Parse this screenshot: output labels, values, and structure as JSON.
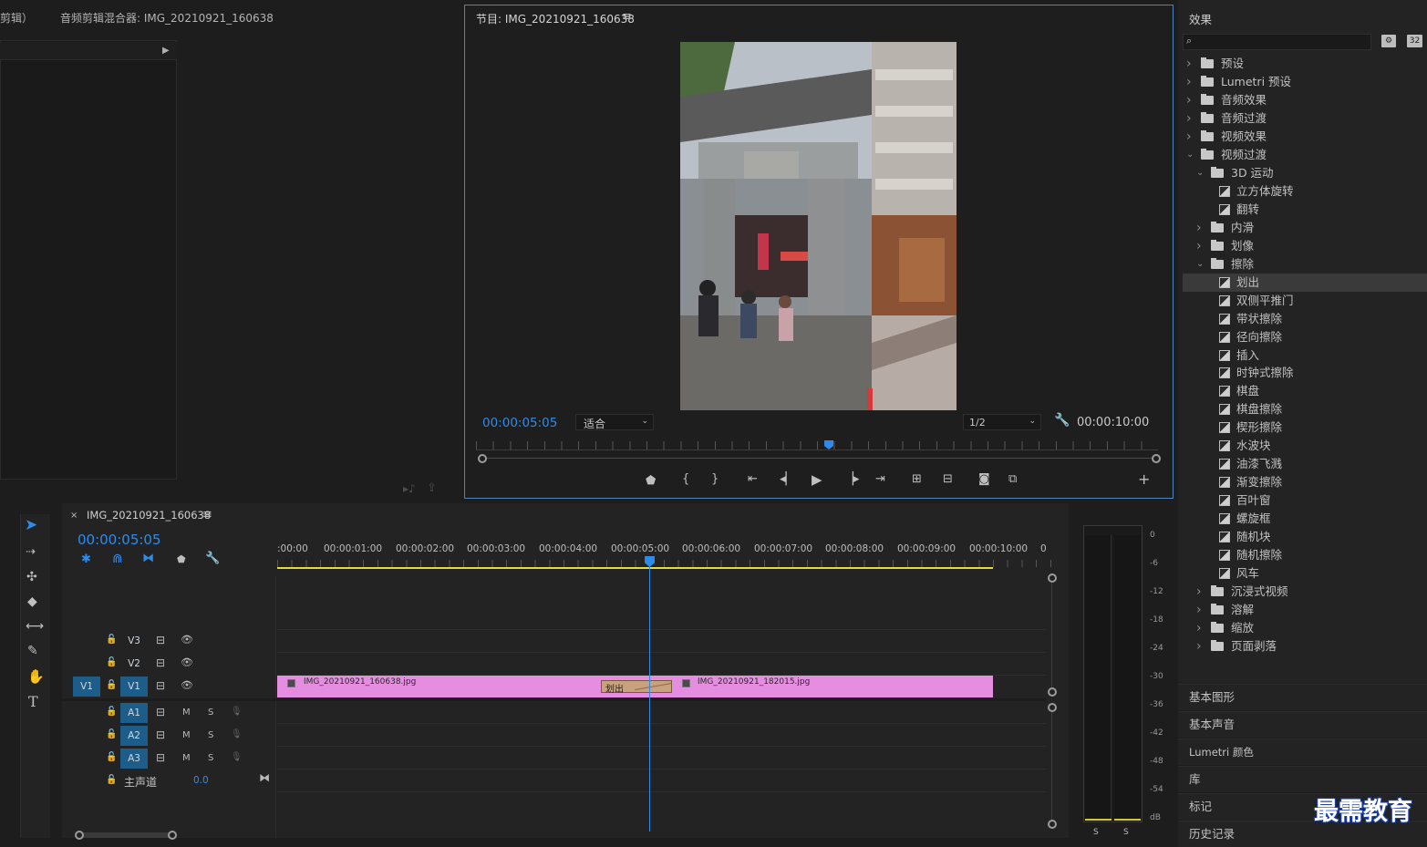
{
  "top_left": {
    "tab_partial": "剪辑）",
    "audio_mixer_title": "音频剪辑混合器: IMG_20210921_160638"
  },
  "program_monitor": {
    "title": "节目: IMG_20210921_160638",
    "menu_icon": "hamburger-icon",
    "timecode": "00:00:05:05",
    "fit_label": "适合",
    "resolution": "1/2",
    "duration": "00:00:10:00",
    "buttons": [
      "marker-icon",
      "mark-in-icon",
      "mark-out-icon",
      "go-to-in-icon",
      "step-back-icon",
      "play-icon",
      "step-forward-icon",
      "go-to-out-icon",
      "lift-icon",
      "extract-icon",
      "camera-icon",
      "compare-icon",
      "add-icon"
    ]
  },
  "effects": {
    "title": "效果",
    "search_placeholder": "",
    "icon_label_32": "32",
    "tree": [
      {
        "label": "预设",
        "level": 0,
        "type": "folder-star",
        "open": false
      },
      {
        "label": "Lumetri 预设",
        "level": 0,
        "type": "folder-star",
        "open": false
      },
      {
        "label": "音频效果",
        "level": 0,
        "type": "folder",
        "open": false
      },
      {
        "label": "音频过渡",
        "level": 0,
        "type": "folder",
        "open": false
      },
      {
        "label": "视频效果",
        "level": 0,
        "type": "folder",
        "open": false
      },
      {
        "label": "视频过渡",
        "level": 0,
        "type": "folder",
        "open": true
      },
      {
        "label": "3D 运动",
        "level": 1,
        "type": "folder",
        "open": true
      },
      {
        "label": "立方体旋转",
        "level": 2,
        "type": "fx"
      },
      {
        "label": "翻转",
        "level": 2,
        "type": "fx"
      },
      {
        "label": "内滑",
        "level": 1,
        "type": "folder",
        "open": false
      },
      {
        "label": "划像",
        "level": 1,
        "type": "folder",
        "open": false
      },
      {
        "label": "擦除",
        "level": 1,
        "type": "folder",
        "open": true
      },
      {
        "label": "划出",
        "level": 2,
        "type": "fx",
        "selected": true
      },
      {
        "label": "双侧平推门",
        "level": 2,
        "type": "fx"
      },
      {
        "label": "带状擦除",
        "level": 2,
        "type": "fx"
      },
      {
        "label": "径向擦除",
        "level": 2,
        "type": "fx"
      },
      {
        "label": "插入",
        "level": 2,
        "type": "fx"
      },
      {
        "label": "时钟式擦除",
        "level": 2,
        "type": "fx"
      },
      {
        "label": "棋盘",
        "level": 2,
        "type": "fx"
      },
      {
        "label": "棋盘擦除",
        "level": 2,
        "type": "fx"
      },
      {
        "label": "楔形擦除",
        "level": 2,
        "type": "fx"
      },
      {
        "label": "水波块",
        "level": 2,
        "type": "fx"
      },
      {
        "label": "油漆飞溅",
        "level": 2,
        "type": "fx"
      },
      {
        "label": "渐变擦除",
        "level": 2,
        "type": "fx"
      },
      {
        "label": "百叶窗",
        "level": 2,
        "type": "fx"
      },
      {
        "label": "螺旋框",
        "level": 2,
        "type": "fx"
      },
      {
        "label": "随机块",
        "level": 2,
        "type": "fx"
      },
      {
        "label": "随机擦除",
        "level": 2,
        "type": "fx"
      },
      {
        "label": "风车",
        "level": 2,
        "type": "fx"
      },
      {
        "label": "沉浸式视频",
        "level": 1,
        "type": "folder",
        "open": false
      },
      {
        "label": "溶解",
        "level": 1,
        "type": "folder",
        "open": false
      },
      {
        "label": "缩放",
        "level": 1,
        "type": "folder",
        "open": false
      },
      {
        "label": "页面剥落",
        "level": 1,
        "type": "folder",
        "open": false
      }
    ]
  },
  "side_panels": [
    "基本图形",
    "基本声音",
    "Lumetri 颜色",
    "库",
    "标记",
    "历史记录"
  ],
  "watermark": "最需教育",
  "timeline": {
    "close_label": "×",
    "sequence_name": "IMG_20210921_160638",
    "timecode": "00:00:05:05",
    "ruler": [
      ":00:00",
      "00:00:01:00",
      "00:00:02:00",
      "00:00:03:00",
      "00:00:04:00",
      "00:00:05:00",
      "00:00:06:00",
      "00:00:07:00",
      "00:00:08:00",
      "00:00:09:00",
      "00:00:10:00",
      "0"
    ],
    "tracks_video": [
      {
        "src": "",
        "name": "V3"
      },
      {
        "src": "",
        "name": "V2"
      },
      {
        "src": "V1",
        "name": "V1"
      }
    ],
    "tracks_audio": [
      {
        "name": "A1",
        "m": "M",
        "s": "S"
      },
      {
        "name": "A2",
        "m": "M",
        "s": "S"
      },
      {
        "name": "A3",
        "m": "M",
        "s": "S"
      }
    ],
    "master": {
      "label": "主声道",
      "value": "0.0"
    },
    "clip1": "IMG_20210921_160638.jpg",
    "clip2": "IMG_20210921_182015.jpg",
    "transition": "划出",
    "colors": {
      "clip": "#e58de0",
      "transition": "#c8a27e",
      "playhead": "#2d8ceb",
      "work_area": "#e6dc2a"
    }
  },
  "meter": {
    "labels": [
      "0",
      "-6",
      "-12",
      "-18",
      "-24",
      "-30",
      "-36",
      "-42",
      "-48",
      "-54",
      "dB"
    ],
    "solo": [
      "S",
      "S"
    ]
  }
}
